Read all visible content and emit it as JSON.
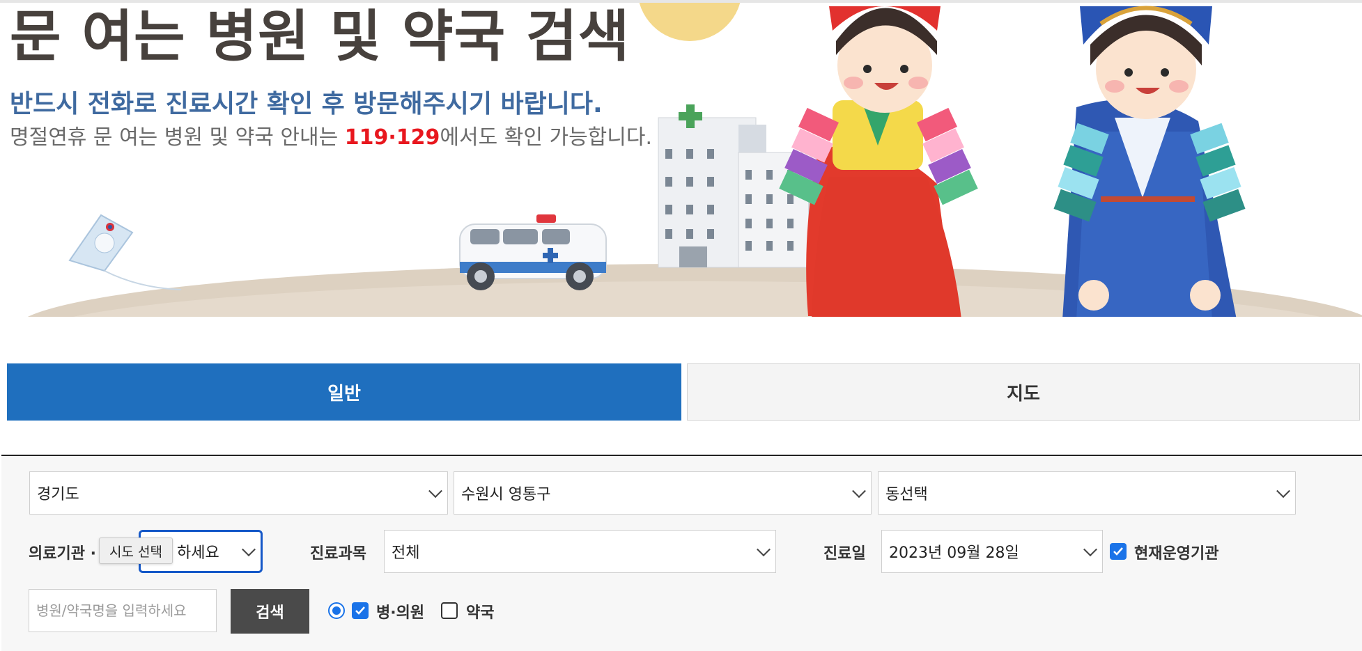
{
  "banner": {
    "title": "문 여는 병원 및 약국 검색",
    "subtitle": "반드시 전화로 진료시간 확인 후 방문해주시기 바랍니다.",
    "notice_prefix": "명절연휴 문 여는 병원 및 약국 안내는 ",
    "notice_highlight": "119·129",
    "notice_suffix": "에서도 확인 가능합니다."
  },
  "tabs": [
    {
      "label": "일반",
      "active": true
    },
    {
      "label": "지도",
      "active": false
    }
  ],
  "filters": {
    "province": "경기도",
    "city": "수원시 영통구",
    "dong": "동선택",
    "institution_label": "의료기관 ·",
    "institution_value": "하세요",
    "tooltip": "시도 선택",
    "department_label": "진료과목",
    "department_value": "전체",
    "date_label": "진료일",
    "date_value": "2023년 09월 28일",
    "open_now_label": "현재운영기관",
    "open_now_checked": true
  },
  "search": {
    "placeholder": "병원/약국명을 입력하세요",
    "button_label": "검색",
    "hospital_label": "병·의원",
    "hospital_checked": true,
    "pharmacy_label": "약국",
    "pharmacy_checked": false
  },
  "colors": {
    "accent": "#1f6fbe",
    "highlight": "#e8171e",
    "subtitle": "#3f6aa0"
  }
}
